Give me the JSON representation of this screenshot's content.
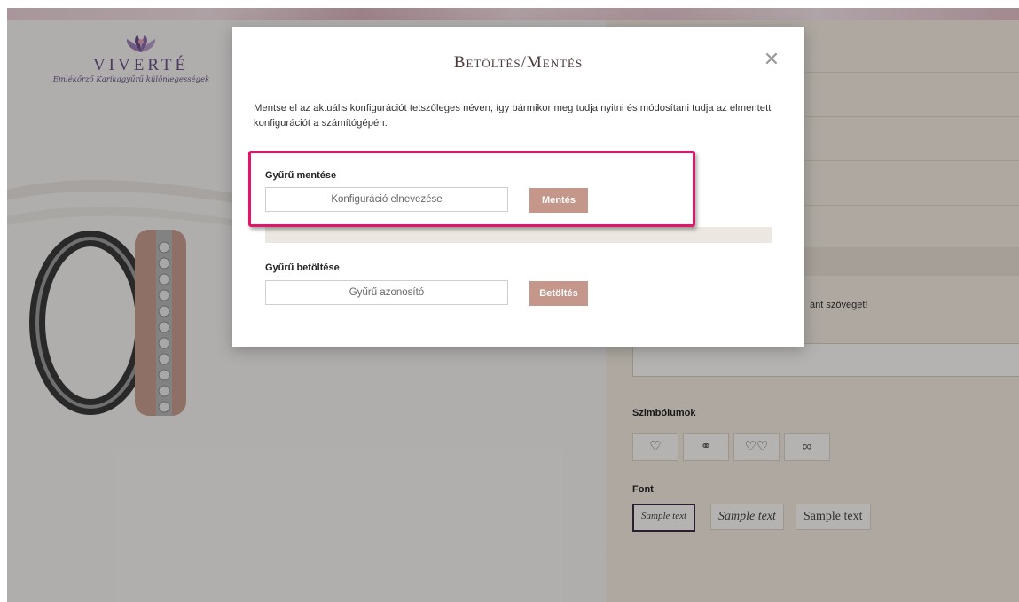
{
  "brand": {
    "name": "VIVERTÉ",
    "tagline": "Emlékőrző Karikagyűrű különlegességek"
  },
  "background_panel": {
    "engrave_hint_text": "ánt szöveget!",
    "symbols_label": "Szimbólumok",
    "symbols": [
      "♡",
      "⚭",
      "♡♡",
      "∞"
    ],
    "font_label": "Font",
    "font_options": [
      "Sample text",
      "Sample text",
      "Sample text"
    ]
  },
  "modal": {
    "title": "Betöltés/Mentés",
    "close_symbol": "✕",
    "description": "Mentse el az aktuális konfigurációt tetszőleges néven, így bármikor meg tudja nyitni és módosítani tudja az elmentett konfigurációt a számítógépén.",
    "save_section": {
      "label": "Gyűrű mentése",
      "input_placeholder": "Konfiguráció elnevezése",
      "button_label": "Mentés"
    },
    "load_section": {
      "label": "Gyűrű betöltése",
      "input_placeholder": "Gyűrű azonosító",
      "button_label": "Betöltés"
    }
  },
  "colors": {
    "accent_button": "#c4978a",
    "highlight_frame": "#e2156b",
    "brand_purple": "#6a4f86"
  }
}
